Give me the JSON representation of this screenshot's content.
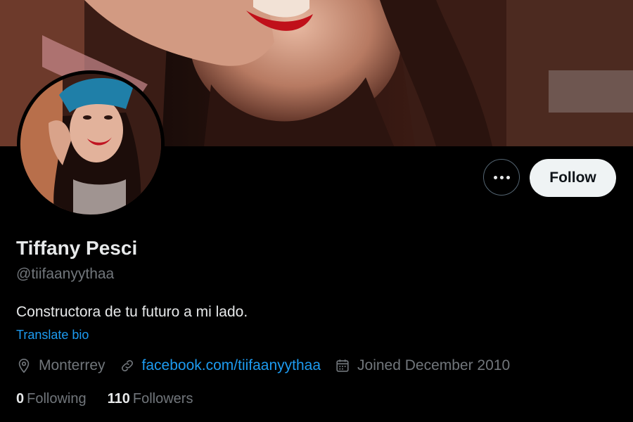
{
  "profile": {
    "name": "Tiffany Pesci",
    "handle": "@tiifaanyythaa",
    "bio": "Constructora de tu futuro a mi lado.",
    "translate_label": "Translate bio"
  },
  "actions": {
    "more_icon": "more-horizontal-icon",
    "follow_label": "Follow"
  },
  "meta": {
    "location": "Monterrey",
    "location_icon": "location-pin-icon",
    "website": "facebook.com/tiifaanyythaa",
    "website_icon": "link-icon",
    "joined": "Joined December 2010",
    "joined_icon": "calendar-icon"
  },
  "stats": {
    "following_count": "0",
    "following_label": "Following",
    "followers_count": "110",
    "followers_label": "Followers"
  },
  "colors": {
    "background": "#000000",
    "text_primary": "#e7e9ea",
    "text_secondary": "#71767b",
    "accent": "#1d9bf0",
    "follow_bg": "#eff3f4"
  }
}
